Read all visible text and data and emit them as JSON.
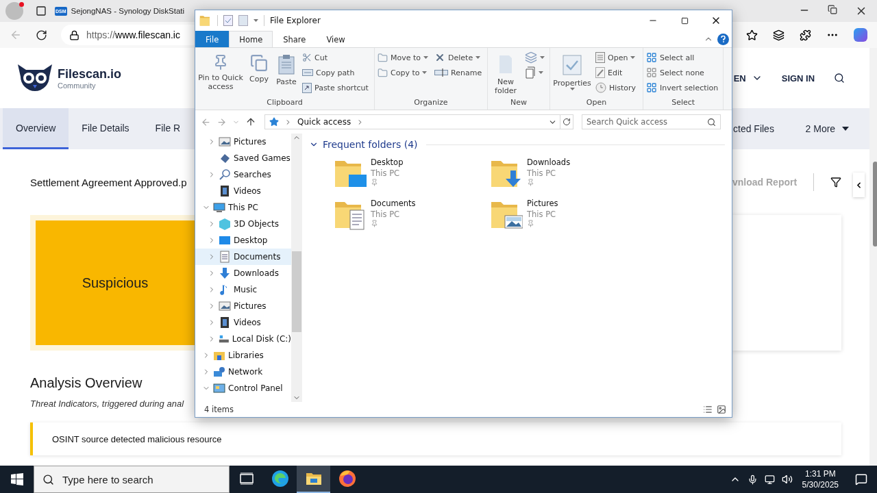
{
  "browser": {
    "tabs": [
      {
        "title": "SejongNAS - Synology DiskStati",
        "favicon": "DSM",
        "selected": false
      }
    ],
    "url_scheme": "https://",
    "url_host": "www.filescan.ic"
  },
  "site": {
    "brand": "Filescan.io",
    "edition": "Community",
    "language": "EN",
    "sign_in": "SIGN IN",
    "nav": [
      {
        "label": "Overview",
        "selected": true
      },
      {
        "label": "File Details",
        "selected": false
      },
      {
        "label": "File R",
        "selected": false
      }
    ],
    "nav_right": [
      {
        "label": "cted Files",
        "kind": "tab"
      },
      {
        "label": "2 More",
        "kind": "menu"
      }
    ],
    "file_name": "Settlement Agreement Approved.p",
    "download": "vnload Report",
    "verdict": "Suspicious",
    "section_title": "Analysis Overview",
    "section_subtitle": "Threat Indicators, triggered during anal",
    "indicator": "OSINT source detected malicious resource"
  },
  "explorer": {
    "title": "File Explorer",
    "ribbon_tabs": [
      {
        "label": "File",
        "kind": "menu",
        "selected": false
      },
      {
        "label": "Home",
        "kind": "tab",
        "selected": true
      },
      {
        "label": "Share",
        "kind": "tab",
        "selected": false
      },
      {
        "label": "View",
        "kind": "tab",
        "selected": false
      }
    ],
    "ribbon_groups": [
      {
        "title": "Clipboard",
        "columns": [
          [
            {
              "kind": "pin",
              "label": "Pin to Quick access"
            }
          ],
          [
            {
              "kind": "copy",
              "label": "Copy"
            }
          ],
          [
            {
              "kind": "paste",
              "label": "Paste"
            }
          ],
          [
            {
              "kind": "cut",
              "label": "Cut"
            },
            {
              "kind": "copy-path",
              "label": "Copy path"
            },
            {
              "kind": "paste-shortcut",
              "label": "Paste shortcut"
            }
          ]
        ]
      },
      {
        "title": "Organize",
        "columns": [
          [
            {
              "kind": "move-to",
              "label": "Move to",
              "menu": true
            },
            {
              "kind": "copy-to",
              "label": "Copy to",
              "menu": true
            }
          ],
          [
            {
              "kind": "delete",
              "label": "Delete",
              "menu": true
            },
            {
              "kind": "rename",
              "label": "Rename"
            }
          ]
        ]
      },
      {
        "title": "New",
        "columns": [
          [
            {
              "kind": "new-folder",
              "label": "New folder"
            }
          ],
          [
            {
              "kind": "new-item",
              "menu": true
            },
            {
              "kind": "easy-access",
              "menu": true
            }
          ]
        ]
      },
      {
        "title": "Open",
        "columns": [
          [
            {
              "kind": "properties",
              "label": "Properties",
              "menu": true
            }
          ],
          [
            {
              "kind": "open",
              "label": "Open",
              "menu": true
            },
            {
              "kind": "edit",
              "label": "Edit"
            },
            {
              "kind": "history",
              "label": "History"
            }
          ]
        ]
      },
      {
        "title": "Select",
        "columns": [
          [
            {
              "kind": "select-all",
              "label": "Select all"
            },
            {
              "kind": "select-none",
              "label": "Select none"
            },
            {
              "kind": "invert",
              "label": "Invert selection"
            }
          ]
        ]
      }
    ],
    "address": "Quick access",
    "search_placeholder": "Search Quick access",
    "nav_tree": [
      {
        "children": [
          {
            "label": "Pictures",
            "kind": "pictures",
            "expanded": false,
            "selected": false
          },
          {
            "label": "Saved Games",
            "kind": "games",
            "selected": false
          },
          {
            "label": "Searches",
            "kind": "searches",
            "expanded": false,
            "selected": false
          },
          {
            "label": "Videos",
            "kind": "videos",
            "selected": false
          }
        ]
      },
      {
        "label": "This PC",
        "kind": "pc",
        "expanded": true,
        "selected": false,
        "children": [
          {
            "label": "3D Objects",
            "kind": "objects",
            "expanded": false,
            "selected": false
          },
          {
            "label": "Desktop",
            "kind": "desktop",
            "expanded": false,
            "selected": false
          },
          {
            "label": "Documents",
            "kind": "documents",
            "expanded": false,
            "selected": true
          },
          {
            "label": "Downloads",
            "kind": "downloads",
            "expanded": false,
            "selected": false
          },
          {
            "label": "Music",
            "kind": "music",
            "expanded": false,
            "selected": false
          },
          {
            "label": "Pictures",
            "kind": "pictures",
            "expanded": false,
            "selected": false
          },
          {
            "label": "Videos",
            "kind": "videos",
            "expanded": false,
            "selected": false
          },
          {
            "label": "Local Disk (C:)",
            "kind": "disk",
            "expanded": false,
            "selected": false
          }
        ]
      },
      {
        "label": "Libraries",
        "kind": "libraries",
        "expanded": false,
        "selected": false
      },
      {
        "label": "Network",
        "kind": "network",
        "expanded": false,
        "selected": false
      },
      {
        "label": "Control Panel",
        "kind": "control-panel",
        "expanded": true,
        "selected": false
      }
    ],
    "section": "Frequent folders (4)",
    "folders": [
      {
        "name": "Desktop",
        "location": "This PC",
        "kind": "desktop"
      },
      {
        "name": "Downloads",
        "location": "This PC",
        "kind": "downloads"
      },
      {
        "name": "Documents",
        "location": "This PC",
        "kind": "documents"
      },
      {
        "name": "Pictures",
        "location": "This PC",
        "kind": "pictures"
      }
    ],
    "status": "4 items"
  },
  "taskbar": {
    "search_placeholder": "Type here to search",
    "apps": [
      {
        "kind": "task-view",
        "selected": false
      },
      {
        "kind": "edge",
        "selected": false
      },
      {
        "kind": "explorer",
        "selected": true
      },
      {
        "kind": "firefox",
        "selected": false
      }
    ],
    "time": "1:31 PM",
    "date": "5/30/2025"
  }
}
